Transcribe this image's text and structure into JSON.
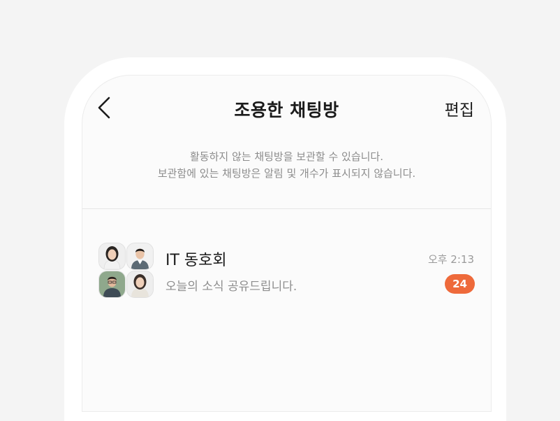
{
  "header": {
    "title": "조용한 채팅방",
    "edit_label": "편집",
    "back_icon": "chevron-left-icon"
  },
  "notice": {
    "line1": "활동하지 않는 채팅방을 보관할 수 있습니다.",
    "line2": "보관함에 있는 채팅방은 알림 및 개수가 표시되지 않습니다."
  },
  "chats": [
    {
      "name": "IT 동호회",
      "preview": "오늘의 소식 공유드립니다.",
      "time": "오후 2:13",
      "unread": "24",
      "avatars": [
        "person-woman-1",
        "person-man-1",
        "person-man-2",
        "person-woman-2"
      ]
    }
  ],
  "colors": {
    "badge": "#ee6a3b",
    "background": "#f4f4f4",
    "screen": "#fbfbfb"
  }
}
